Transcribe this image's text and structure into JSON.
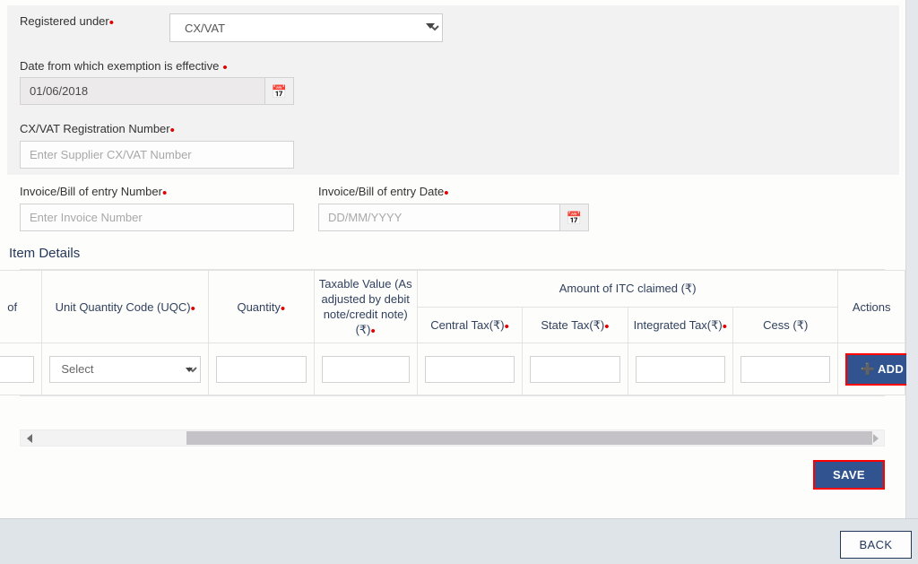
{
  "supplier_panel": {
    "registered_under": {
      "label": "Registered under",
      "required": true,
      "value": "CX/VAT",
      "options": [
        "CX/VAT"
      ]
    },
    "exemption_date": {
      "label": "Date from which exemption is effective",
      "required": true,
      "value": "01/06/2018",
      "calendar_icon": "calendar-icon"
    },
    "registration_number": {
      "label": "CX/VAT Registration Number",
      "required": true,
      "value": "",
      "placeholder": "Enter Supplier CX/VAT Number"
    }
  },
  "invoice": {
    "number": {
      "label": "Invoice/Bill of entry Number",
      "required": true,
      "value": "",
      "placeholder": "Enter Invoice Number"
    },
    "date": {
      "label": "Invoice/Bill of entry Date",
      "required": true,
      "value": "",
      "placeholder": "DD/MM/YYYY",
      "calendar_icon": "calendar-icon"
    }
  },
  "item_details": {
    "heading": "Item Details",
    "group_header": "Amount of ITC claimed (₹)",
    "actions_header": "Actions",
    "columns": [
      {
        "label": "of",
        "required": false,
        "truncated": true
      },
      {
        "label": "Unit Quantity Code (UQC)",
        "required": true
      },
      {
        "label": "Quantity",
        "required": true
      },
      {
        "label": "Taxable Value (As adjusted by debit note/credit note) (₹)",
        "required": true
      },
      {
        "label": "Central Tax(₹)",
        "required": true
      },
      {
        "label": "State Tax(₹)",
        "required": true
      },
      {
        "label": "Integrated Tax(₹)",
        "required": true
      },
      {
        "label": "Cess (₹)",
        "required": false
      }
    ],
    "row": {
      "hsn_value": "",
      "uqc_value": "Select",
      "uqc_options": [
        "Select"
      ],
      "quantity_value": "",
      "taxable_value": "",
      "central_tax_value": "",
      "state_tax_value": "",
      "integrated_tax_value": "",
      "cess_value": "",
      "add_label": "ADD",
      "add_plus_icon": "plus-icon"
    }
  },
  "scrollbar": {
    "left_arrow_icon": "chevron-left-icon",
    "right_arrow_icon": "chevron-right-icon"
  },
  "actions": {
    "save_label": "SAVE",
    "back_label": "BACK"
  },
  "colors": {
    "primary_button": "#31538f",
    "focus_outline": "#ff0000",
    "required_marker": "#e00000",
    "heading": "#24385b",
    "panel_grey": "#f2f2f2",
    "footer": "#dfe4e9"
  }
}
